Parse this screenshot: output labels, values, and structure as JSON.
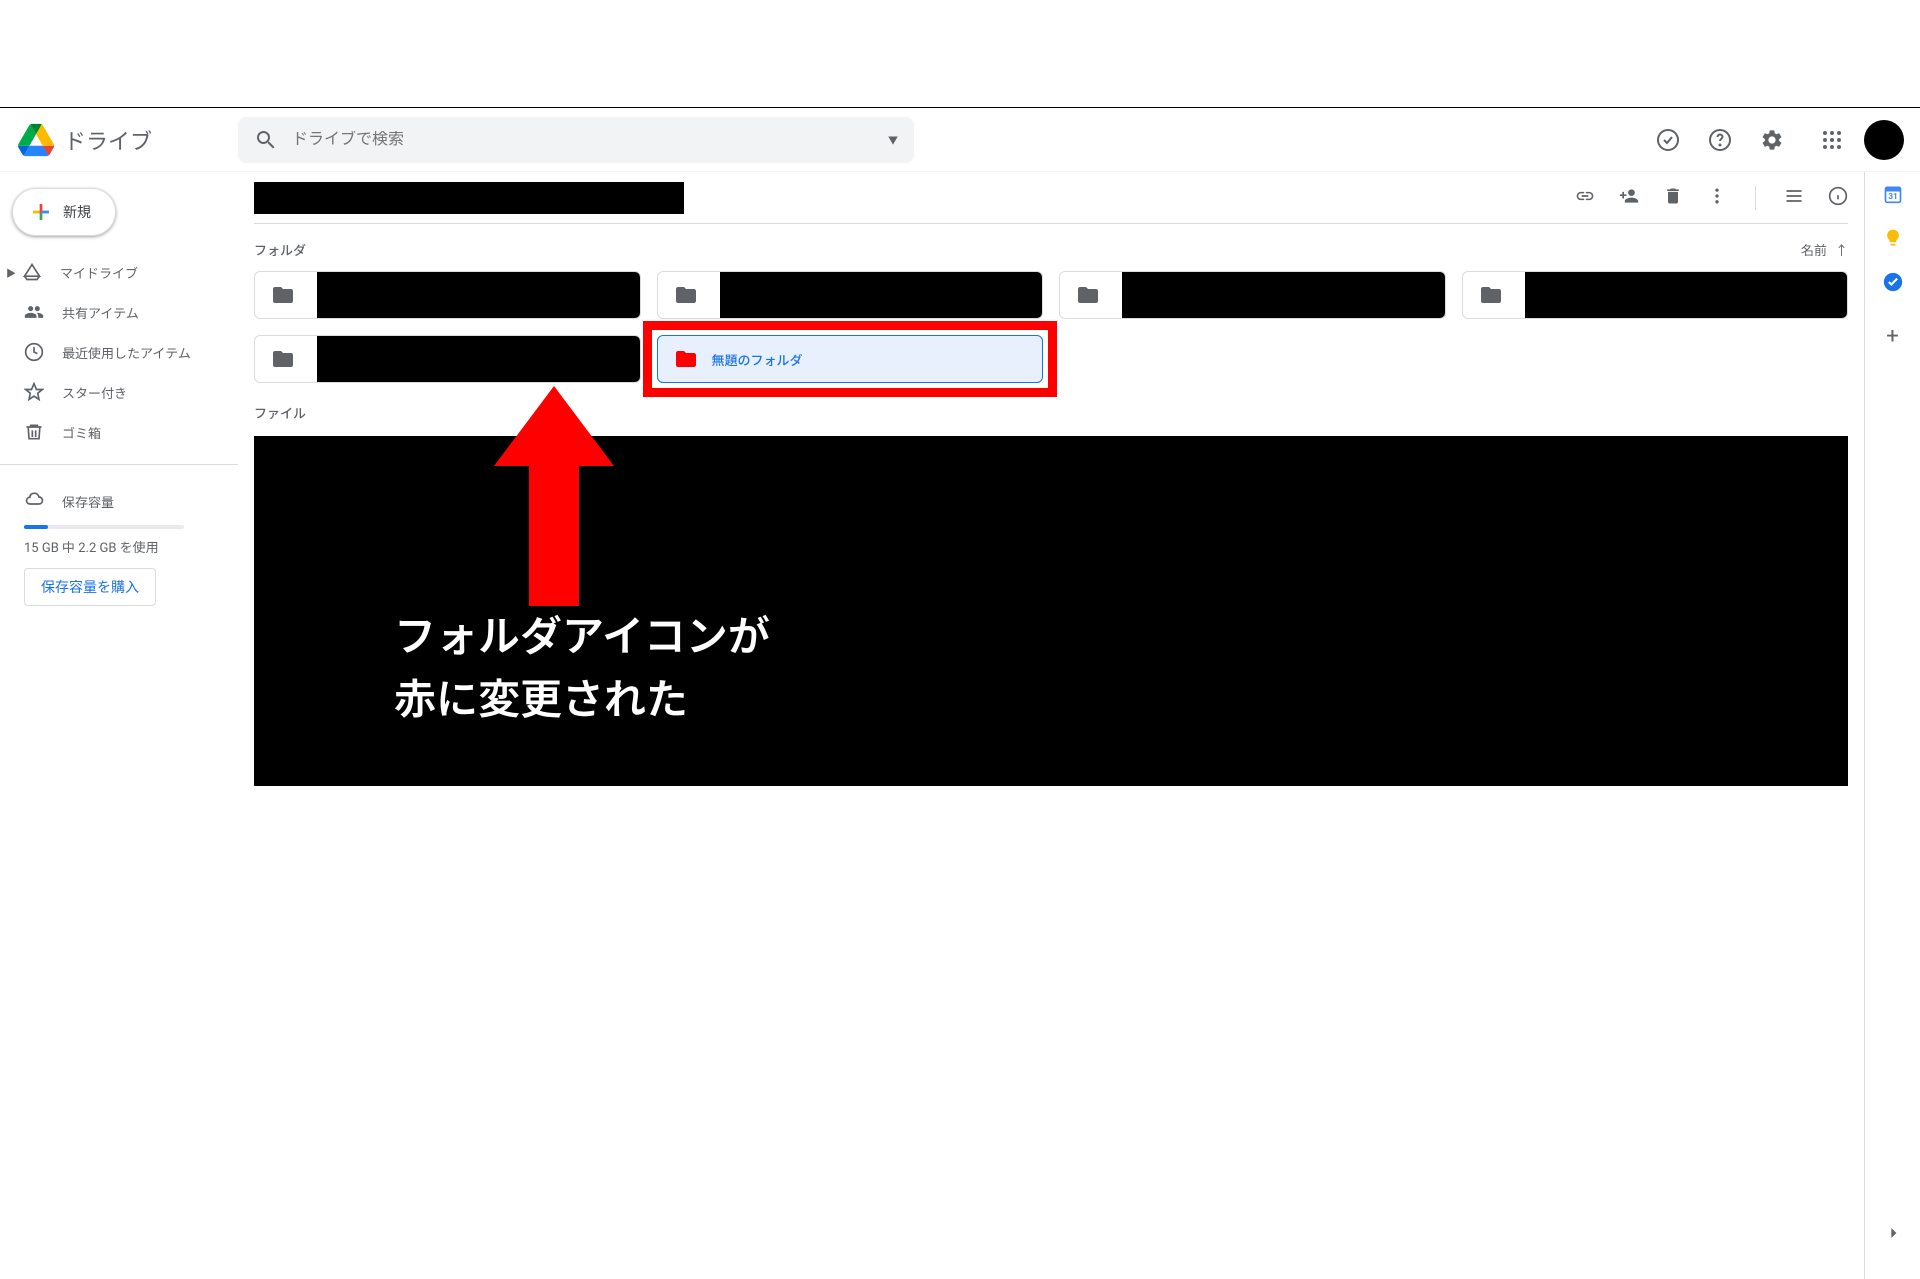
{
  "brand": "ドライブ",
  "search": {
    "placeholder": "ドライブで検索"
  },
  "new_button": "新規",
  "sidebar": {
    "mydrive": "マイドライブ",
    "shared": "共有アイテム",
    "recent": "最近使用したアイテム",
    "starred": "スター付き",
    "trash": "ゴミ箱",
    "storage_label": "保存容量",
    "storage_usage": "15 GB 中 2.2 GB を使用",
    "buy_storage": "保存容量を購入"
  },
  "section": {
    "folders": "フォルダ",
    "files": "ファイル",
    "sort_name": "名前"
  },
  "selected_folder": {
    "label": "無題のフォルダ",
    "icon_color": "#FF0000"
  },
  "annotation": {
    "line1": "フォルダアイコンが",
    "line2": "赤に変更された"
  },
  "colors": {
    "folder_default": "#5f6368",
    "folder_red": "#FF0000",
    "accent_blue": "#1a73e8"
  }
}
